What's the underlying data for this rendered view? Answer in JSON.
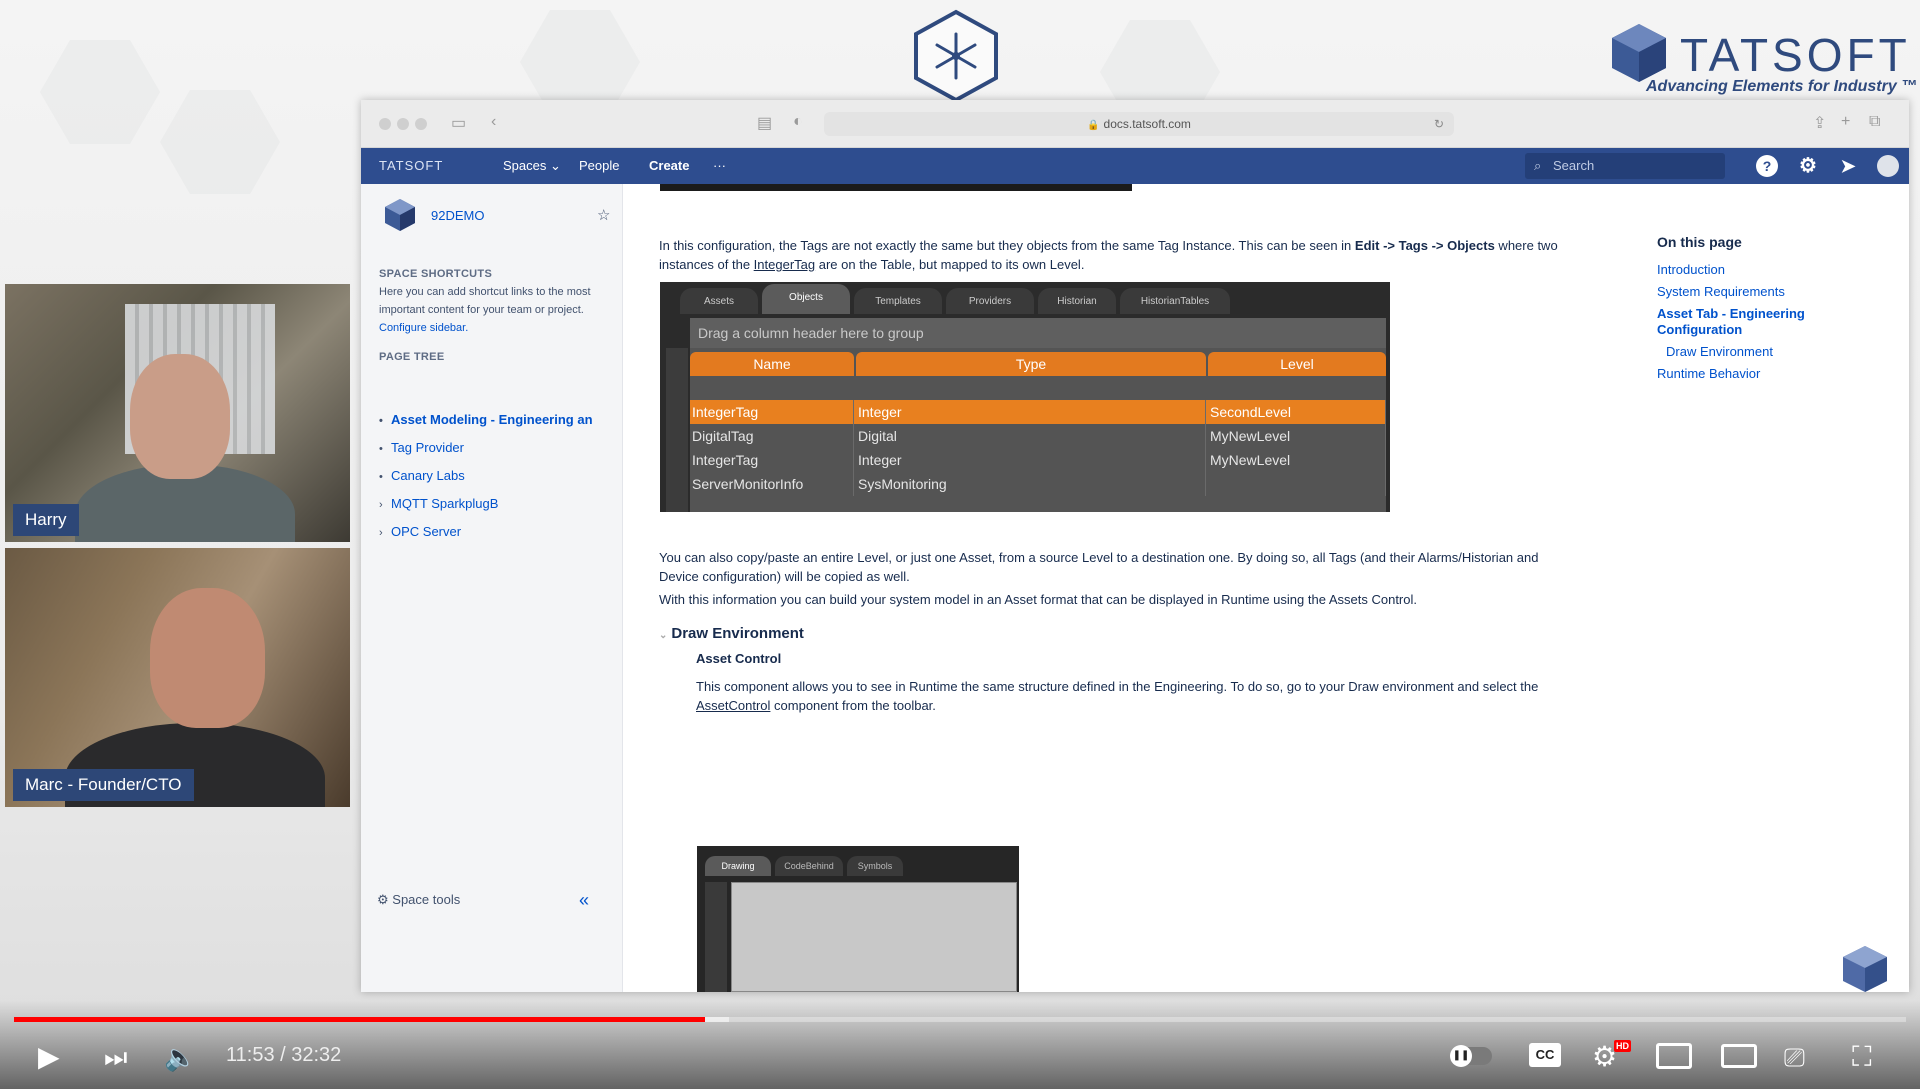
{
  "brand": {
    "name": "TATSOFT",
    "tagline": "Advancing Elements for Industry ™"
  },
  "webcams": [
    {
      "label": "Harry"
    },
    {
      "label": "Marc - Founder/CTO"
    }
  ],
  "browser": {
    "url": "docs.tatsoft.com"
  },
  "confluence_header": {
    "logo": "TATSOFT",
    "nav": [
      "Spaces",
      "People",
      "Create",
      "···"
    ],
    "search_placeholder": "Search",
    "icons": [
      "help-icon",
      "settings-icon",
      "notifications-icon",
      "profile-icon"
    ]
  },
  "sidebar": {
    "space_name": "92DEMO",
    "shortcuts_heading": "SPACE SHORTCUTS",
    "shortcuts_text": "Here you can add shortcut links to the most important content for your team or project.",
    "shortcuts_link": "Configure sidebar.",
    "page_tree_heading": "PAGE TREE",
    "page_tree": [
      {
        "label": "Asset Modeling - Engineering an",
        "bullet": "•",
        "current": true
      },
      {
        "label": "Tag Provider",
        "bullet": "•"
      },
      {
        "label": "Canary Labs",
        "bullet": "•"
      },
      {
        "label": "MQTT SparkplugB",
        "bullet": "›"
      },
      {
        "label": "OPC Server",
        "bullet": "›"
      }
    ],
    "space_tools": "Space tools",
    "collapse_label": "«"
  },
  "content": {
    "para1_a": "In this configuration, the Tags are not exactly the same but they objects from the same Tag Instance. This can be seen in ",
    "para1_b": "Edit -> Tags -> Objects",
    "para1_c": " where two instances of the ",
    "para1_d": "IntegerTag",
    "para1_e": " are on the Table, but mapped to its own Level.",
    "grid": {
      "tabs": [
        "Assets",
        "Objects",
        "Templates",
        "Providers",
        "Historian",
        "HistorianTables"
      ],
      "active_tab": "Objects",
      "drag_hint": "Drag a column header here to group",
      "columns": [
        "Name",
        "Type",
        "Level"
      ],
      "rows": [
        [
          "IntegerTag",
          "Integer",
          "SecondLevel"
        ],
        [
          "DigitalTag",
          "Digital",
          "MyNewLevel"
        ],
        [
          "IntegerTag",
          "Integer",
          "MyNewLevel"
        ],
        [
          "ServerMonitorInfo",
          "SysMonitoring",
          ""
        ]
      ],
      "selected_row": 0
    },
    "para2": "You can also copy/paste an entire Level, or just one Asset, from a source Level to a destination one. By doing so, all Tags (and their Alarms/Historian and Device configuration) will be copied as well.",
    "para3": "With this information you can build your system model in an Asset format that can be displayed in Runtime using the Assets Control.",
    "section_title": "Draw Environment",
    "subsection_title": "Asset Control",
    "para4_a": "This component allows you to see in Runtime the same structure defined in the Engineering. To do so, go to your Draw environment and select the ",
    "para4_b": "AssetControl",
    "para4_c": " component from the toolbar.",
    "draw_tabs": [
      "Drawing",
      "CodeBehind",
      "Symbols"
    ]
  },
  "toc": {
    "heading": "On this page",
    "items": [
      "Introduction",
      "System Requirements",
      "Asset Tab - Engineering Configuration",
      "Draw Environment",
      "Runtime Behavior"
    ]
  },
  "player": {
    "time": "11:53 / 32:32",
    "played_fraction": 0.365,
    "buffered_fraction": 0.378,
    "cc_label": "CC",
    "hd_label": "HD"
  }
}
